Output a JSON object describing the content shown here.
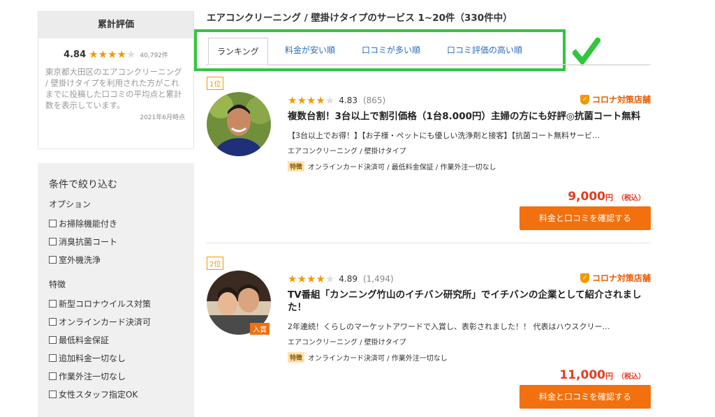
{
  "sidebar": {
    "rating_box": {
      "heading": "累計評価",
      "score": "4.84",
      "stars": "★★★★",
      "star_off": "★",
      "count": "40,792件",
      "description": "東京都大田区のエアコンクリーニング / 壁掛けタイプを利用された方がこれまでに投稿した口コミの平均点と累計数を表示しています。",
      "date": "2021年6月時点"
    },
    "filter": {
      "title": "条件で絞り込む",
      "options_heading": "オプション",
      "options": [
        "お掃除機能付き",
        "消臭抗菌コート",
        "室外機洗浄"
      ],
      "features_heading": "特徴",
      "features": [
        "新型コロナウイルス対策",
        "オンラインカード決済可",
        "最低料金保証",
        "追加料金一切なし",
        "作業外注一切なし",
        "女性スタッフ指定OK"
      ]
    }
  },
  "main": {
    "title": "エアコンクリーニング / 壁掛けタイプのサービス 1~20件（330件中）",
    "tabs": [
      {
        "label": "ランキング"
      },
      {
        "label": "料金が安い順"
      },
      {
        "label": "口コミが多い順"
      },
      {
        "label": "口コミ評価の高い順"
      }
    ],
    "cards": [
      {
        "rank": "1位",
        "stars": "★★★★",
        "star_off": "★",
        "score": "4.83",
        "reviews": "(865)",
        "badge": "コロナ対策店舗",
        "title": "複数台割！3台以上で割引価格（1台8.000円）主婦の方にも好評◎抗菌コート無料",
        "desc": "【3台以上でお得！】【お子様・ペットにも優しい洗浄剤と接客】【抗菌コート無料サービ…",
        "category": "エアコンクリーニング / 壁掛けタイプ",
        "feature_tag": "特徴",
        "features": "オンラインカード決済可 / 最低料金保証 / 作業外注一切なし",
        "price": "9,000",
        "price_unit": "円",
        "price_tax": "（税込）",
        "cta": "料金と口コミを確認する"
      },
      {
        "rank": "2位",
        "stars": "★★★★",
        "star_off": "★",
        "score": "4.89",
        "reviews": "(1,494)",
        "badge": "コロナ対策店舗",
        "title": "TV番組「カンニング竹山のイチバン研究所」でイチバンの企業として紹介されました！",
        "desc": "2年連続！くらしのマーケットアワードで入賞し、表彰されました！！ 代表はハウスクリー…",
        "category": "エアコンクリーニング / 壁掛けタイプ",
        "feature_tag": "特徴",
        "features": "オンラインカード決済可 / 作業外注一切なし",
        "price": "11,000",
        "price_unit": "円",
        "price_tax": "（税込）",
        "cta": "料金と口コミを確認する",
        "avatar_tag": "入賞"
      }
    ]
  },
  "colors": {
    "accent": "#f2700e",
    "price": "#e83a1e",
    "star": "#f39800",
    "link": "#2a6ebb",
    "highlight": "#2fc73e"
  }
}
